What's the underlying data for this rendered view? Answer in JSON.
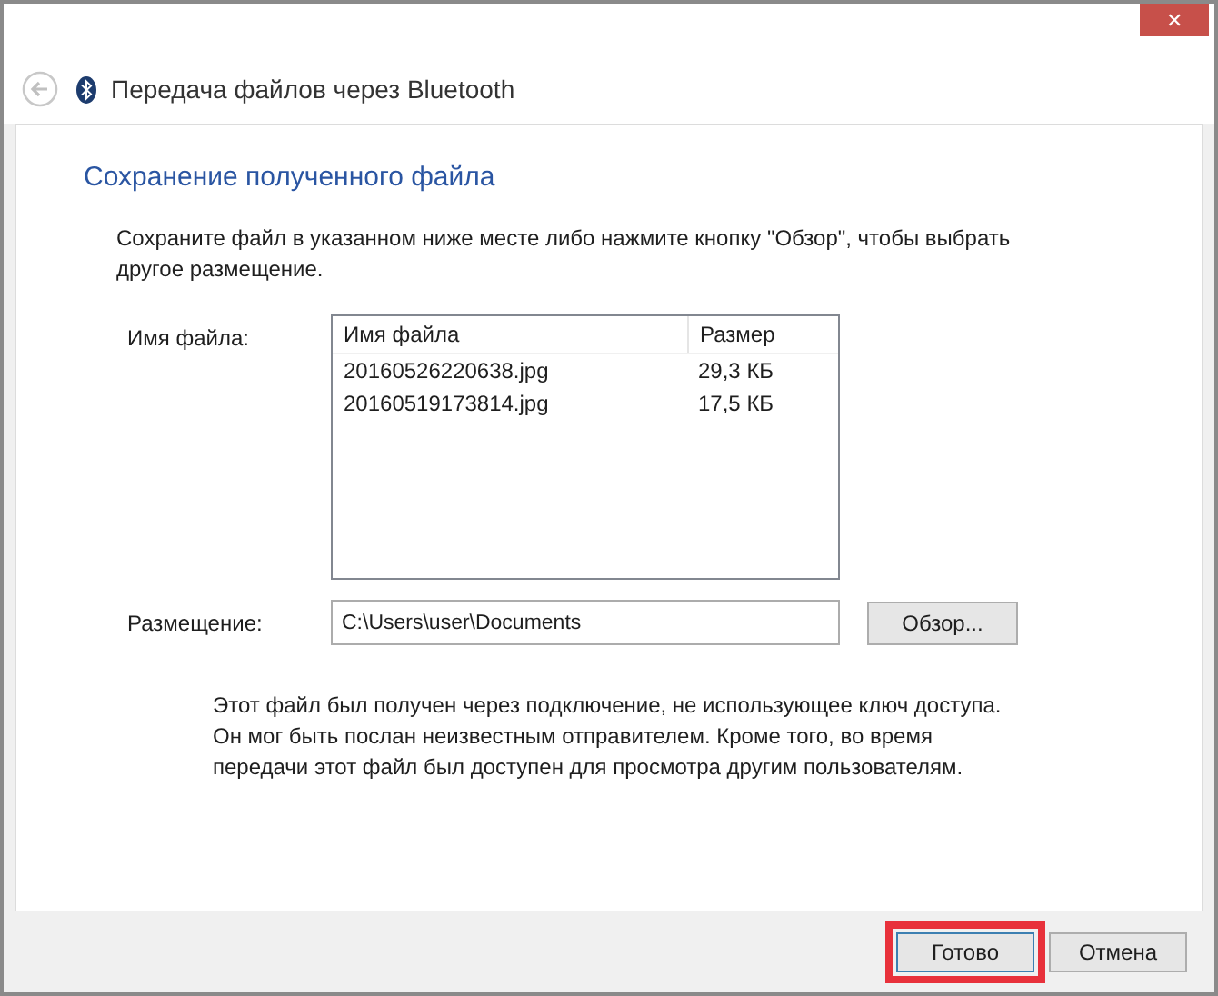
{
  "window": {
    "title": "Передача файлов через Bluetooth",
    "close_label": "✕"
  },
  "heading": "Сохранение полученного файла",
  "instruction": "Сохраните файл в указанном ниже месте либо нажмите кнопку \"Обзор\", чтобы выбрать другое размещение.",
  "file_label": "Имя файла:",
  "file_list": {
    "columns": [
      "Имя файла",
      "Размер"
    ],
    "rows": [
      {
        "name": "20160526220638.jpg",
        "size": "29,3 КБ"
      },
      {
        "name": "20160519173814.jpg",
        "size": "17,5 КБ"
      }
    ]
  },
  "location_label": "Размещение:",
  "location_value": "C:\\Users\\user\\Documents",
  "browse_button": "Обзор...",
  "notice": "Этот файл был получен через подключение, не использующее ключ доступа. Он мог быть послан неизвестным отправителем.  Кроме того, во время передачи этот файл был доступен для просмотра другим пользователям.",
  "buttons": [
    {
      "label": "Готово",
      "highlighted": true
    },
    {
      "label": "Отмена",
      "highlighted": false
    }
  ]
}
